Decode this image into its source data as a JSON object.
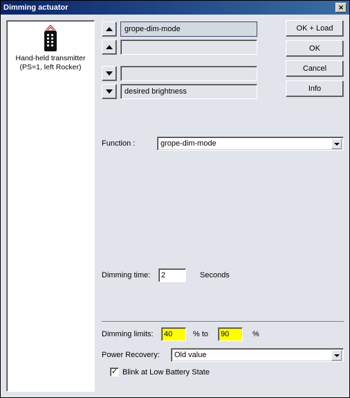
{
  "title": "Dimming actuator",
  "left": {
    "device_line1": "Hand-held transmitter",
    "device_line2": "(PS=1, left Rocker)"
  },
  "buttons": {
    "ok_load": "OK + Load",
    "ok": "OK",
    "cancel": "Cancel",
    "info": "Info"
  },
  "actions": {
    "row0": "grope-dim-mode",
    "row1": "",
    "row2": "",
    "row3": "desired brightness"
  },
  "function_label": "Function :",
  "function_value": "grope-dim-mode",
  "dimming_time_label": "Dimming time:",
  "dimming_time_value": "2",
  "dimming_time_unit": "Seconds",
  "dimming_limits_label": "Dimming limits:",
  "dimming_limits_min": "40",
  "dimming_limits_to": "% to",
  "dimming_limits_max": "90",
  "dimming_limits_pct": "%",
  "power_recovery_label": "Power Recovery:",
  "power_recovery_value": "Old value",
  "blink_label": "Blink at Low Battery State",
  "blink_checked": true
}
